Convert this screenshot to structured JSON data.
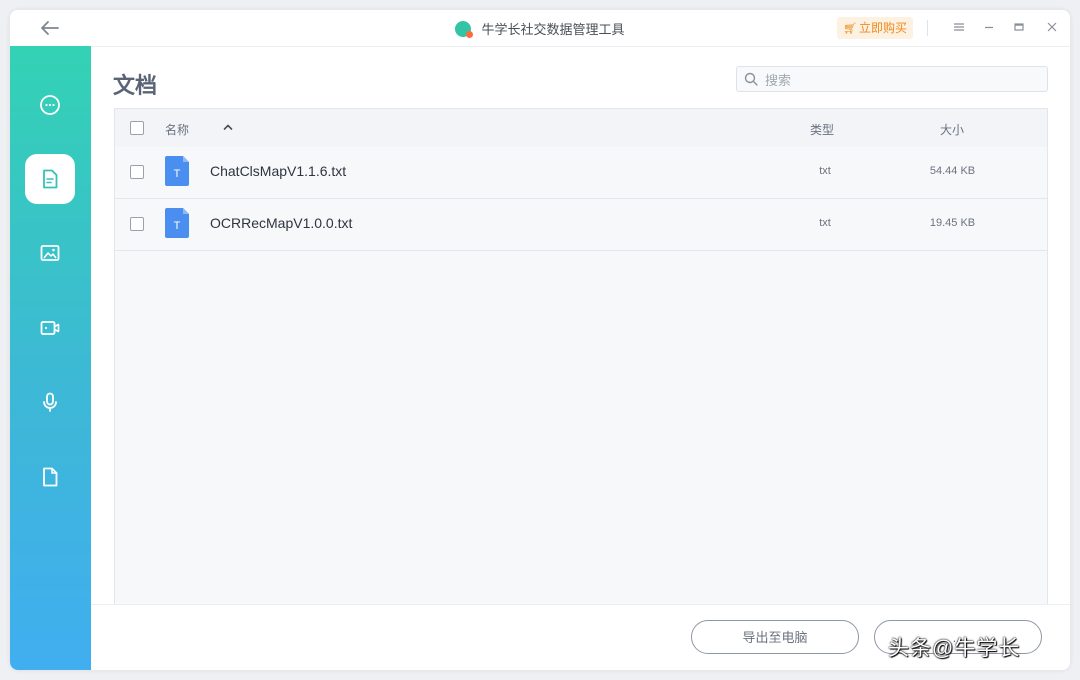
{
  "titlebar": {
    "app_title": "牛学长社交数据管理工具",
    "buy_label": "立即购买"
  },
  "sidebar": {
    "items": [
      {
        "name": "messages",
        "icon": "chat-bubble-icon",
        "active": false
      },
      {
        "name": "documents",
        "icon": "document-icon",
        "active": true
      },
      {
        "name": "images",
        "icon": "image-icon",
        "active": false
      },
      {
        "name": "videos",
        "icon": "video-icon",
        "active": false
      },
      {
        "name": "audio",
        "icon": "microphone-icon",
        "active": false
      },
      {
        "name": "files",
        "icon": "file-icon",
        "active": false
      }
    ]
  },
  "main": {
    "title": "文档",
    "search": {
      "placeholder": "搜索",
      "value": ""
    },
    "table": {
      "columns": {
        "name": "名称",
        "type": "类型",
        "size": "大小"
      },
      "rows": [
        {
          "icon_letter": "T",
          "name": "ChatClsMapV1.1.6.txt",
          "type": "txt",
          "size": "54.44 KB"
        },
        {
          "icon_letter": "T",
          "name": "OCRRecMapV1.0.0.txt",
          "type": "txt",
          "size": "19.45 KB"
        }
      ]
    }
  },
  "footer": {
    "export_label": "导出至电脑",
    "second_label": "..."
  },
  "watermark": "头条@牛学长",
  "colors": {
    "accent_teal": "#33d2b4",
    "accent_blue": "#41aef0",
    "file_icon_blue": "#4a8ef0",
    "buy_orange": "#ec8a1c"
  }
}
